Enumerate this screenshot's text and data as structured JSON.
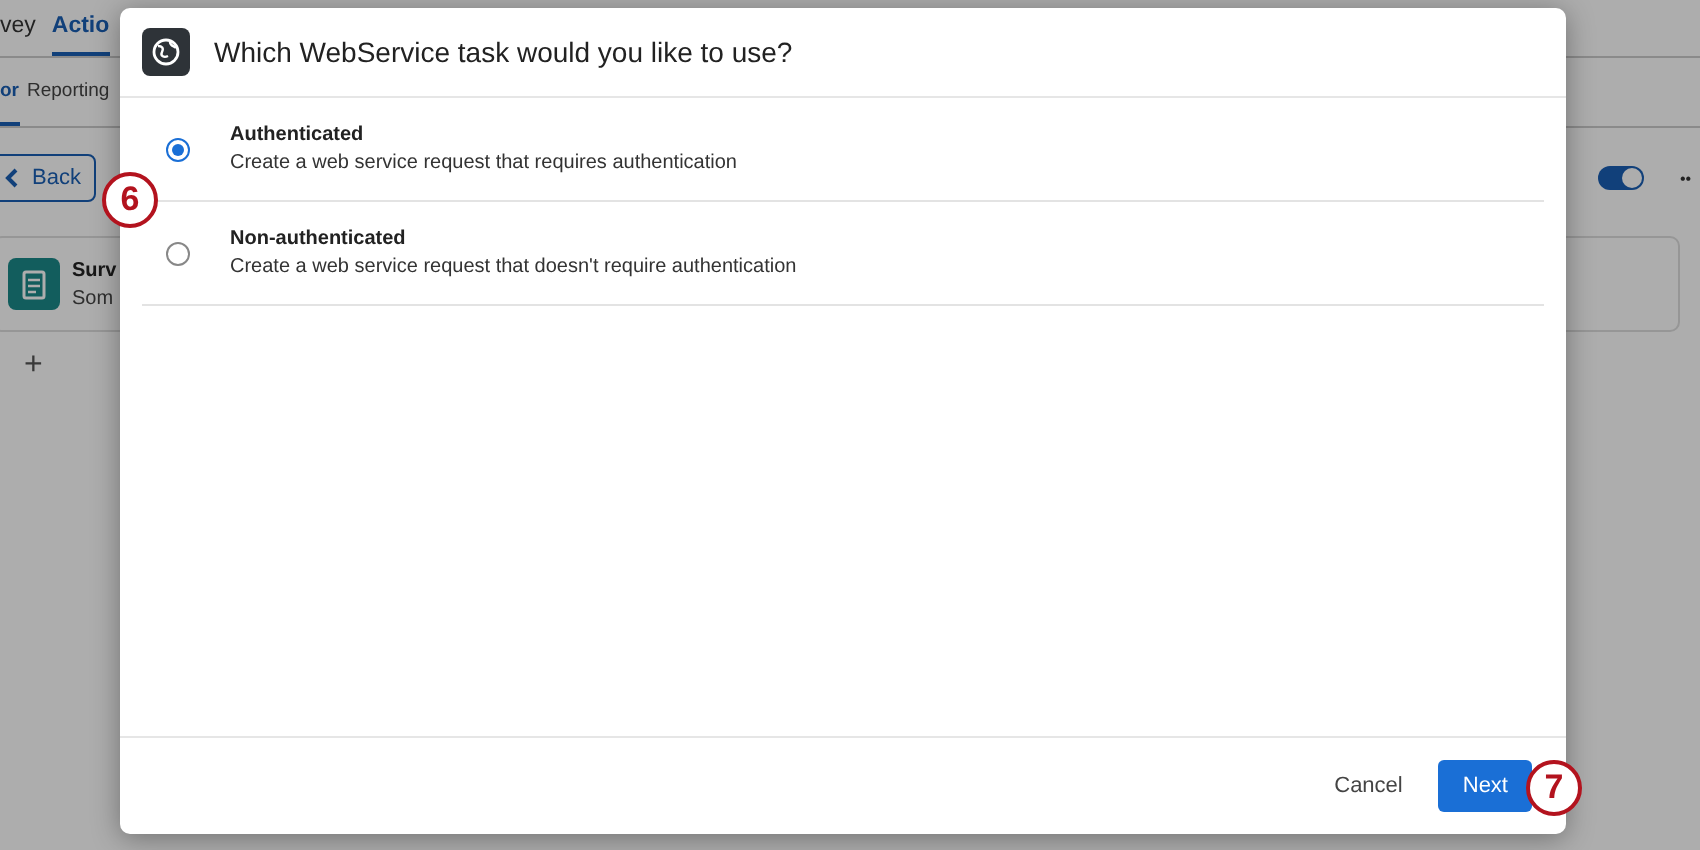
{
  "background": {
    "top_tabs": [
      {
        "label": "vey",
        "selected": false
      },
      {
        "label": "Actio",
        "selected": true
      }
    ],
    "sub_tabs": [
      {
        "label": "or",
        "selected": true
      },
      {
        "label": "Reporting",
        "selected": false
      }
    ],
    "back_button": "Back",
    "toggle": {
      "on": true
    },
    "more": "••",
    "card": {
      "title": "Surv",
      "subtitle": "Som"
    },
    "add": "+"
  },
  "dialog": {
    "title": "Which WebService task would you like to use?",
    "options": [
      {
        "title": "Authenticated",
        "description": "Create a web service request that requires authentication",
        "selected": true
      },
      {
        "title": "Non-authenticated",
        "description": "Create a web service request that doesn't require authentication",
        "selected": false
      }
    ],
    "buttons": [
      {
        "label": "Cancel",
        "kind": "secondary"
      },
      {
        "label": "Next",
        "kind": "primary"
      }
    ]
  },
  "callouts": [
    "6",
    "7"
  ]
}
